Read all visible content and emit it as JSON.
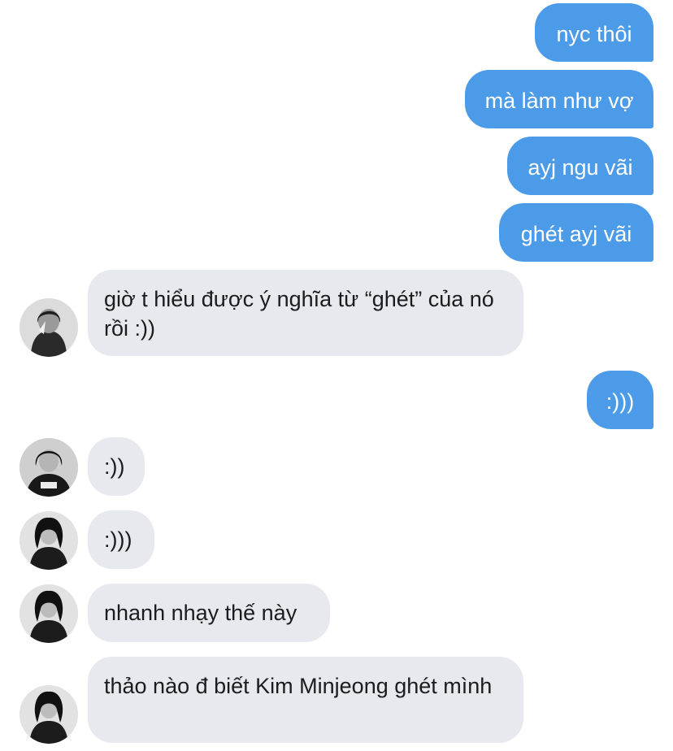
{
  "conversation": {
    "outgoing": [
      {
        "text": "nyc thôi"
      },
      {
        "text": "mà làm như vợ"
      },
      {
        "text": "ayj ngu vãi"
      },
      {
        "text": "ghét ayj vãi"
      },
      {
        "text": ":)))"
      }
    ],
    "incoming": [
      {
        "text": "giờ t hiểu được ý nghĩa từ “ghét” của nó rồi :))"
      },
      {
        "text": ":))"
      },
      {
        "text": ":)))"
      },
      {
        "text": "nhanh nhạy thế này"
      },
      {
        "text": "thảo nào đ biết Kim Minjeong ghét mình"
      }
    ]
  },
  "colors": {
    "outgoing_bubble": "#4c9be8",
    "incoming_bubble": "#e7e9ee",
    "background": "#ffffff"
  },
  "icons": {
    "avatar": "avatar-icon"
  }
}
